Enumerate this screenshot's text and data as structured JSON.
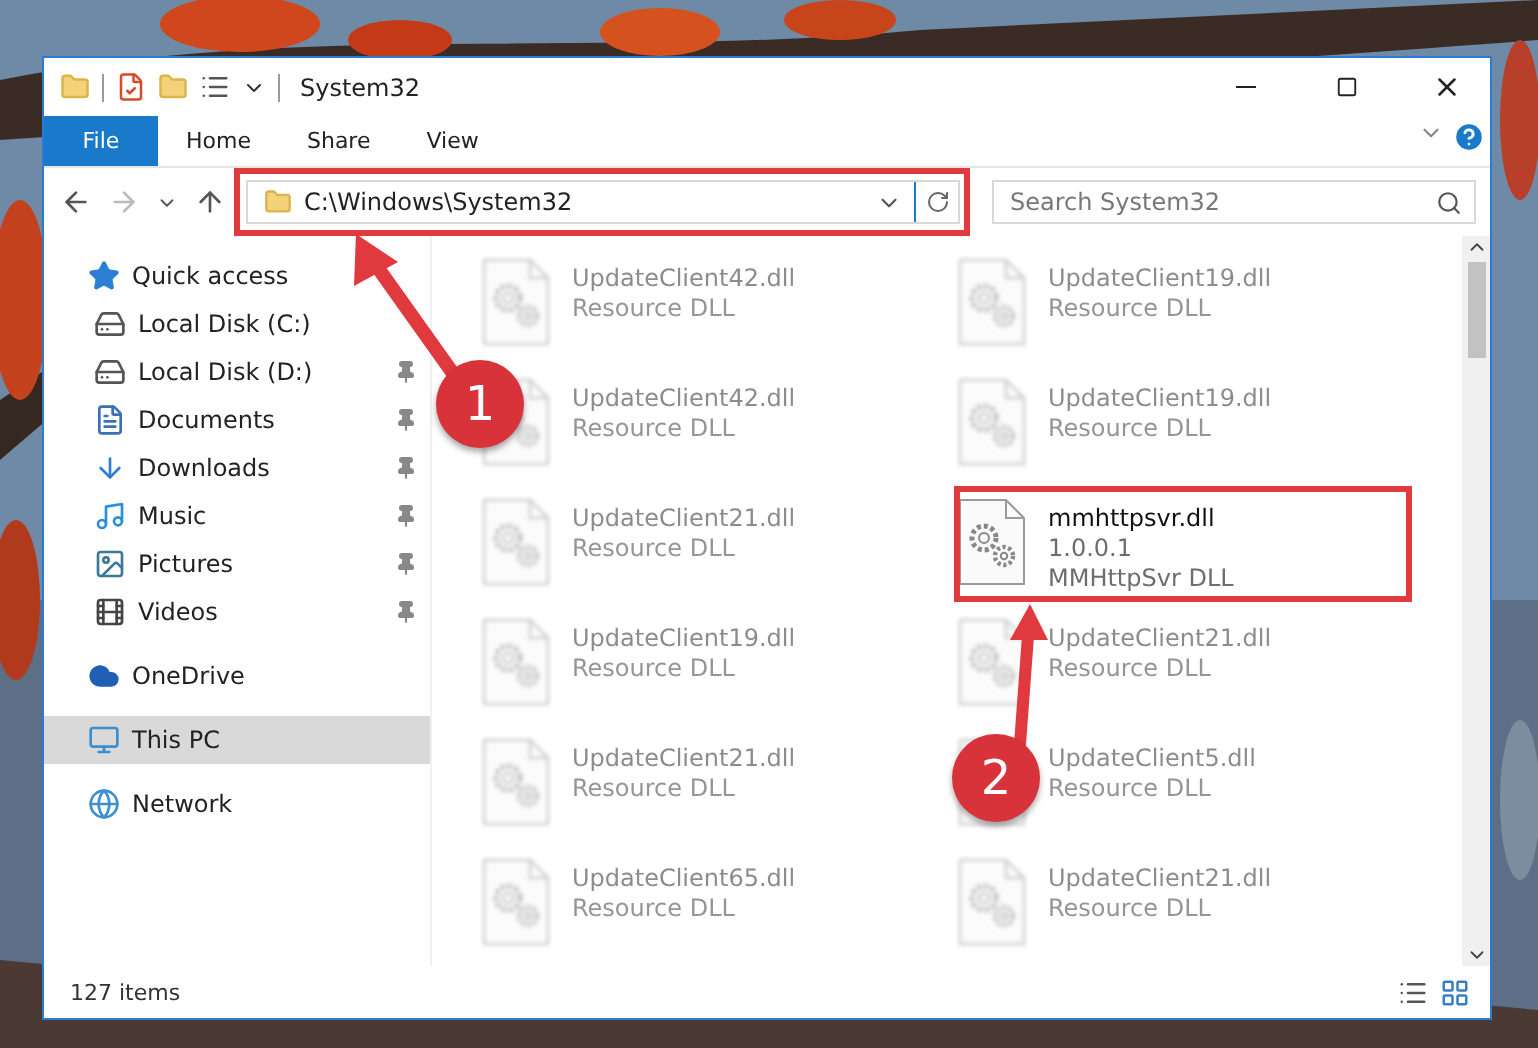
{
  "window": {
    "title": "System32"
  },
  "ribbon_tabs": [
    {
      "label": "File",
      "selected": true
    },
    {
      "label": "Home",
      "selected": false
    },
    {
      "label": "Share",
      "selected": false
    },
    {
      "label": "View",
      "selected": false
    }
  ],
  "address_bar": {
    "path": "C:\\Windows\\System32"
  },
  "search": {
    "placeholder": "Search System32"
  },
  "sidebar": {
    "items": [
      {
        "label": "Quick access",
        "kind": "star",
        "selected": false,
        "children": [
          {
            "label": "Local Disk (C:)",
            "kind": "system-drive",
            "pinned": false
          },
          {
            "label": "Local Disk (D:)",
            "kind": "drive",
            "pinned": true
          },
          {
            "label": "Documents",
            "kind": "documents",
            "pinned": true
          },
          {
            "label": "Downloads",
            "kind": "downloads",
            "pinned": true
          },
          {
            "label": "Music",
            "kind": "music",
            "pinned": true
          },
          {
            "label": "Pictures",
            "kind": "pictures",
            "pinned": true
          },
          {
            "label": "Videos",
            "kind": "videos",
            "pinned": true
          }
        ]
      },
      {
        "label": "OneDrive",
        "kind": "cloud",
        "selected": false
      },
      {
        "label": "This PC",
        "kind": "pc",
        "selected": true
      },
      {
        "label": "Network",
        "kind": "network",
        "selected": false
      }
    ]
  },
  "files": [
    {
      "name": "UpdateClient42.dll",
      "lines": [
        "Resource DLL"
      ],
      "blurred": true
    },
    {
      "name": "UpdateClient19.dll",
      "lines": [
        "Resource DLL"
      ],
      "blurred": true
    },
    {
      "name": "UpdateClient42.dll",
      "lines": [
        "Resource DLL"
      ],
      "blurred": true
    },
    {
      "name": "UpdateClient19.dll",
      "lines": [
        "Resource DLL"
      ],
      "blurred": true
    },
    {
      "name": "UpdateClient21.dll",
      "lines": [
        "Resource DLL"
      ],
      "blurred": true
    },
    {
      "name": "mmhttpsvr.dll",
      "lines": [
        "1.0.0.1",
        "MMHttpSvr DLL"
      ],
      "blurred": false
    },
    {
      "name": "UpdateClient19.dll",
      "lines": [
        "Resource DLL"
      ],
      "blurred": true
    },
    {
      "name": "UpdateClient21.dll",
      "lines": [
        "Resource DLL"
      ],
      "blurred": true
    },
    {
      "name": "UpdateClient21.dll",
      "lines": [
        "Resource DLL"
      ],
      "blurred": true
    },
    {
      "name": "UpdateClient5.dll",
      "lines": [
        "Resource DLL"
      ],
      "blurred": true
    },
    {
      "name": "UpdateClient65.dll",
      "lines": [
        "Resource DLL"
      ],
      "blurred": true
    },
    {
      "name": "UpdateClient21.dll",
      "lines": [
        "Resource DLL"
      ],
      "blurred": true
    }
  ],
  "status_bar": {
    "count": "127 items"
  },
  "callouts": [
    {
      "number": "1"
    },
    {
      "number": "2"
    }
  ]
}
